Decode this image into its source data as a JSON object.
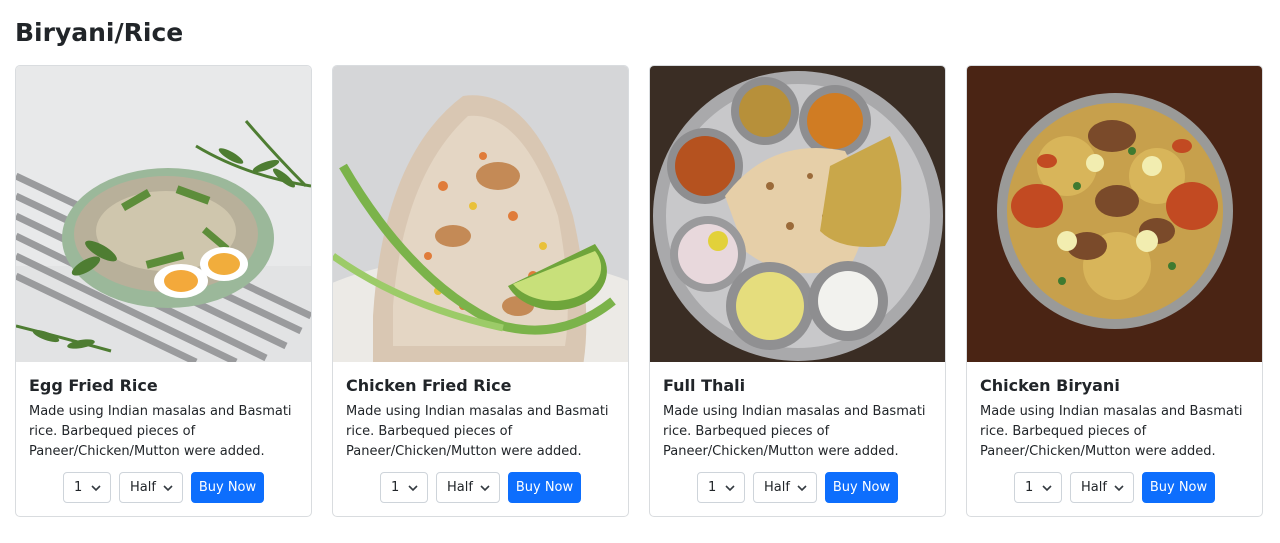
{
  "section": {
    "title": "Biryani/Rice"
  },
  "products": [
    {
      "name": "Egg Fried Rice",
      "description": "Made using Indian masalas and Basmati rice. Barbequed pieces of Paneer/Chicken/Mutton were added.",
      "quantity": "1",
      "portion": "Half",
      "buy_label": "Buy Now",
      "image_alt": "egg fried rice photo"
    },
    {
      "name": "Chicken Fried Rice",
      "description": "Made using Indian masalas and Basmati rice. Barbequed pieces of Paneer/Chicken/Mutton were added.",
      "quantity": "1",
      "portion": "Half",
      "buy_label": "Buy Now",
      "image_alt": "chicken fried rice photo"
    },
    {
      "name": "Full Thali",
      "description": "Made using Indian masalas and Basmati rice. Barbequed pieces of Paneer/Chicken/Mutton were added.",
      "quantity": "1",
      "portion": "Half",
      "buy_label": "Buy Now",
      "image_alt": "full thali photo"
    },
    {
      "name": "Chicken Biryani",
      "description": "Made using Indian masalas and Basmati rice. Barbequed pieces of Paneer/Chicken/Mutton were added.",
      "quantity": "1",
      "portion": "Half",
      "buy_label": "Buy Now",
      "image_alt": "chicken biryani photo"
    }
  ],
  "colors": {
    "primary": "#0d6efd",
    "border": "#d9dcdf"
  }
}
